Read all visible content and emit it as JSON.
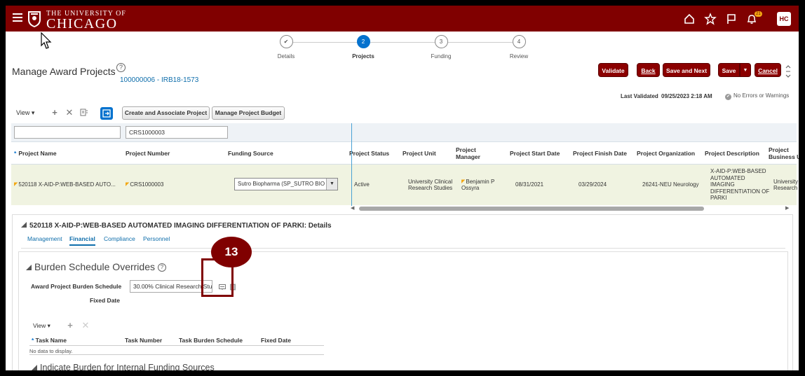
{
  "header": {
    "logo_small": "THE UNIVERSITY OF",
    "logo_big": "CHICAGO",
    "notification_count": "21",
    "user_initials": "HC",
    "brand_color": "#800000"
  },
  "train": {
    "steps": [
      {
        "number": "",
        "label": "Details",
        "state": "complete"
      },
      {
        "number": "2",
        "label": "Projects",
        "state": "active"
      },
      {
        "number": "3",
        "label": "Funding",
        "state": "pending"
      },
      {
        "number": "4",
        "label": "Review",
        "state": "pending"
      }
    ]
  },
  "page": {
    "title": "Manage Award Projects",
    "help": "?",
    "award_link": "100000006 - IRB18-1573"
  },
  "actions": {
    "validate": "Validate",
    "back": "Back",
    "save_and_next": "Save and Next",
    "save": "Save",
    "save_menu": "▼",
    "cancel": "Cancel"
  },
  "status": {
    "last_validated_label": "Last Validated",
    "last_validated_value": "09/25/2023 2:18 AM",
    "errors": "No Errors or Warnings"
  },
  "toolbar": {
    "view": "View",
    "create_associate": "Create and Associate Project",
    "manage_budget": "Manage Project Budget"
  },
  "projects_table": {
    "filter_project_number": "CRS1000003",
    "columns": {
      "project_name": "Project Name",
      "project_number": "Project Number",
      "funding_source": "Funding Source",
      "project_status": "Project Status",
      "project_unit": "Project Unit",
      "project_manager": "Project Manager",
      "start_date": "Project Start Date",
      "finish_date": "Project Finish Date",
      "organization": "Project Organization",
      "description": "Project Description",
      "business_unit": "Project Business Unit"
    },
    "row": {
      "project_name": "520118 X-AID-P:WEB-BASED AUTO...",
      "project_number": "CRS1000003",
      "funding_source": "Sutro Biopharma (SP_SUTRO BIO",
      "project_status": "Active",
      "project_unit": "University Clinical Research Studies",
      "project_manager": "Benjamin P Ossyra",
      "start_date": "08/31/2021",
      "finish_date": "03/29/2024",
      "organization": "26241-NEU Neurology",
      "description": "X-AID-P:WEB-BASED AUTOMATED IMAGING DIFFERENTIATION OF PARKI",
      "business_unit": "University Research"
    }
  },
  "details": {
    "title": "520118 X-AID-P:WEB-BASED AUTOMATED IMAGING DIFFERENTIATION OF PARKI: Details",
    "tabs": [
      "Management",
      "Financial",
      "Compliance",
      "Personnel"
    ],
    "active_tab": "Financial",
    "burden": {
      "title": "Burden Schedule Overrides",
      "schedule_label": "Award Project Burden Schedule",
      "schedule_value": "30.00% Clinical Research Stu",
      "fixed_date_label": "Fixed Date"
    },
    "callout_number": "13",
    "sub_table": {
      "view": "View",
      "columns": [
        "Task Name",
        "Task Number",
        "Task Burden Schedule",
        "Fixed Date"
      ],
      "empty": "No data to display."
    },
    "internal_funding_title": "Indicate Burden for Internal Funding Sources"
  }
}
